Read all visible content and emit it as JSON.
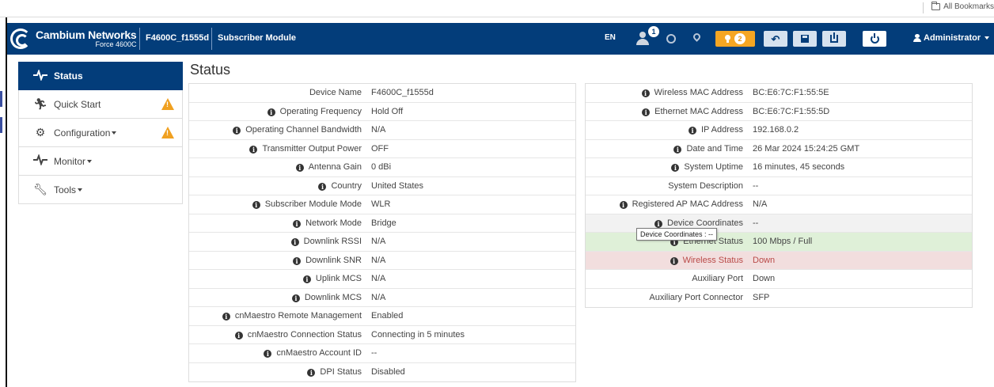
{
  "browser": {
    "bookmarks_label": "All Bookmarks"
  },
  "navbar": {
    "brand_name": "Cambium Networks",
    "brand_model": "Force 4600C",
    "device_name": "F4600C_f1555d",
    "device_mode": "Subscriber Module",
    "language": "EN",
    "user_notification_count": "1",
    "alert_count": "2",
    "admin_label": "Administrator"
  },
  "sidebar": {
    "items": [
      {
        "label": "Status",
        "icon": "pulse-icon",
        "active": true,
        "warning": false
      },
      {
        "label": "Quick Start",
        "icon": "running-icon",
        "active": false,
        "warning": true
      },
      {
        "label": "Configuration",
        "icon": "gear-icon",
        "active": false,
        "warning": true
      },
      {
        "label": "Monitor",
        "icon": "pulse-icon",
        "active": false,
        "warning": false
      },
      {
        "label": "Tools",
        "icon": "wrench-icon",
        "active": false,
        "warning": false
      }
    ]
  },
  "page": {
    "title": "Status"
  },
  "left_table": [
    {
      "label": "Device Name",
      "value": "F4600C_f1555d",
      "info": false
    },
    {
      "label": "Operating Frequency",
      "value": "Hold Off",
      "info": true
    },
    {
      "label": "Operating Channel Bandwidth",
      "value": "N/A",
      "info": true
    },
    {
      "label": "Transmitter Output Power",
      "value": "OFF",
      "info": true
    },
    {
      "label": "Antenna Gain",
      "value": "0 dBi",
      "info": true
    },
    {
      "label": "Country",
      "value": "United States",
      "info": true
    },
    {
      "label": "Subscriber Module Mode",
      "value": "WLR",
      "info": true
    },
    {
      "label": "Network Mode",
      "value": "Bridge",
      "info": true
    },
    {
      "label": "Downlink RSSI",
      "value": "N/A",
      "info": true
    },
    {
      "label": "Downlink SNR",
      "value": "N/A",
      "info": true
    },
    {
      "label": "Uplink MCS",
      "value": "N/A",
      "info": true
    },
    {
      "label": "Downlink MCS",
      "value": "N/A",
      "info": true
    },
    {
      "label": "cnMaestro Remote Management",
      "value": "Enabled",
      "info": true
    },
    {
      "label": "cnMaestro Connection Status",
      "value": "Connecting in 5 minutes",
      "info": true
    },
    {
      "label": "cnMaestro Account ID",
      "value": "--",
      "info": true
    },
    {
      "label": "DPI Status",
      "value": "Disabled",
      "info": true
    }
  ],
  "right_table": [
    {
      "label": "Wireless MAC Address",
      "value": "BC:E6:7C:F1:55:5E",
      "info": true,
      "state": ""
    },
    {
      "label": "Ethernet MAC Address",
      "value": "BC:E6:7C:F1:55:5D",
      "info": true,
      "state": ""
    },
    {
      "label": "IP Address",
      "value": "192.168.0.2",
      "info": true,
      "state": ""
    },
    {
      "label": "Date and Time",
      "value": "26 Mar 2024 15:24:25 GMT",
      "info": true,
      "state": ""
    },
    {
      "label": "System Uptime",
      "value": "16 minutes, 45 seconds",
      "info": true,
      "state": ""
    },
    {
      "label": "System Description",
      "value": "--",
      "info": false,
      "state": ""
    },
    {
      "label": "Registered AP MAC Address",
      "value": "N/A",
      "info": true,
      "state": ""
    },
    {
      "label": "Device Coordinates",
      "value": "--",
      "info": true,
      "state": "gray"
    },
    {
      "label": "Ethernet Status",
      "value": "100 Mbps / Full",
      "info": true,
      "state": "green"
    },
    {
      "label": "Wireless Status",
      "value": "Down",
      "info": true,
      "state": "red"
    },
    {
      "label": "Auxiliary Port",
      "value": "Down",
      "info": false,
      "state": ""
    },
    {
      "label": "Auxiliary Port Connector",
      "value": "SFP",
      "info": false,
      "state": ""
    }
  ],
  "tooltip": {
    "text": "Device Coordinates : --"
  },
  "colors": {
    "navbar": "#033d7a",
    "alert": "#f5a623",
    "success_row": "#dff0d8",
    "danger_row": "#f2dede"
  }
}
